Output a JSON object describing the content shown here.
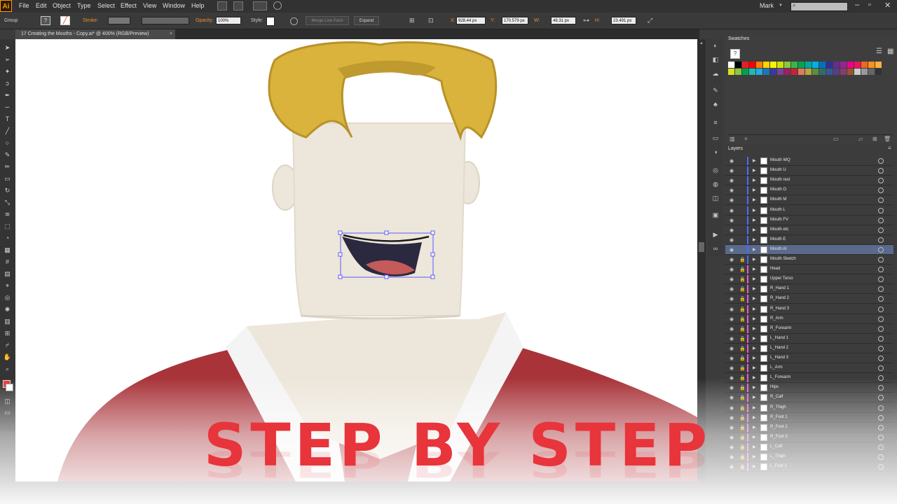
{
  "app": {
    "logo": "Ai",
    "user": "Mark"
  },
  "menu": [
    "File",
    "Edit",
    "Object",
    "Type",
    "Select",
    "Effect",
    "View",
    "Window",
    "Help"
  ],
  "control_bar": {
    "selection_type": "Group",
    "stroke_label": "Stroke:",
    "opacity_label": "Opacity:",
    "opacity_value": "100%",
    "style_label": "Style:",
    "merge_label": "Merge Live Paint",
    "expand_label": "Expand",
    "x_label": "X:",
    "x_value": "928.44 px",
    "y_label": "Y:",
    "y_value": "170.579 px",
    "w_label": "W:",
    "w_value": "48.31 px",
    "h_label": "H:",
    "h_value": "23.491 px"
  },
  "document": {
    "tab_title": "17 Creating the Mouths - Copy.ai* @ 400% (RGB/Preview)"
  },
  "panels": {
    "swatches_title": "Swatches",
    "layers_title": "Layers"
  },
  "layers": [
    {
      "name": "Mouth WQ",
      "color": "#4f6bff"
    },
    {
      "name": "Mouth U",
      "color": "#4f6bff"
    },
    {
      "name": "Mouth rest",
      "color": "#4f6bff"
    },
    {
      "name": "Mouth O",
      "color": "#4f6bff"
    },
    {
      "name": "Mouth M",
      "color": "#4f6bff"
    },
    {
      "name": "Mouth L",
      "color": "#4f6bff"
    },
    {
      "name": "Mouth FV",
      "color": "#4f6bff"
    },
    {
      "name": "Mouth etc",
      "color": "#4f6bff"
    },
    {
      "name": "Mouth E",
      "color": "#4f6bff"
    },
    {
      "name": "Mouth AI",
      "color": "#4f6bff",
      "selected": true
    },
    {
      "name": "Mouth Sketch",
      "color": "#4f6bff"
    },
    {
      "name": "Head",
      "color": "#e05bd8"
    },
    {
      "name": "Upper Torso",
      "color": "#e05bd8"
    },
    {
      "name": "R_Hand 1",
      "color": "#e05bd8"
    },
    {
      "name": "R_Hand 2",
      "color": "#e05bd8"
    },
    {
      "name": "R_Hand 3",
      "color": "#e05bd8"
    },
    {
      "name": "R_Arm",
      "color": "#e05bd8"
    },
    {
      "name": "R_Forearm",
      "color": "#e05bd8"
    },
    {
      "name": "L_Hand 1",
      "color": "#e05bd8"
    },
    {
      "name": "L_Hand 2",
      "color": "#e05bd8"
    },
    {
      "name": "L_Hand 3",
      "color": "#e05bd8"
    },
    {
      "name": "L_Arm",
      "color": "#e05bd8"
    },
    {
      "name": "L_Forearm",
      "color": "#e05bd8"
    },
    {
      "name": "Hips",
      "color": "#e05bd8"
    },
    {
      "name": "R_Calf",
      "color": "#e05bd8"
    },
    {
      "name": "R_Thigh",
      "color": "#e05bd8"
    },
    {
      "name": "R_Foot 1",
      "color": "#e05bd8"
    },
    {
      "name": "R_Foot 2",
      "color": "#e05bd8"
    },
    {
      "name": "R_Foot 3",
      "color": "#e05bd8"
    },
    {
      "name": "L_Calf",
      "color": "#e05bd8"
    },
    {
      "name": "L_Thigh",
      "color": "#e05bd8"
    },
    {
      "name": "L_Foot 1",
      "color": "#e05bd8"
    }
  ],
  "swatch_colors": [
    "#ffffff",
    "#000000",
    "#ed1c24",
    "#ff0000",
    "#ff7f00",
    "#ffd200",
    "#fff200",
    "#c8e600",
    "#8dc63f",
    "#39b54a",
    "#00a651",
    "#00a99d",
    "#00aeef",
    "#0072bc",
    "#2e3192",
    "#662d91",
    "#92278f",
    "#ec008c",
    "#ed145b",
    "#f26522",
    "#f7941d",
    "#fbb040",
    "#d7df23",
    "#8bc541",
    "#00a14b",
    "#1cbbb4",
    "#27aae1",
    "#1c75bc",
    "#3a3a9a",
    "#7f3f98",
    "#9e1f63",
    "#c1272d",
    "#e07a5f",
    "#b5a642",
    "#5a8f3a",
    "#2a6f6f",
    "#35589a",
    "#5a3d8a",
    "#8a3a6f",
    "#a0522d",
    "#cccccc",
    "#999999",
    "#666666",
    "#333333"
  ],
  "overlay": {
    "headline": "STEP BY STEP"
  },
  "colors": {
    "accent": "#e8343b",
    "hair": "#d9b33b",
    "skin": "#ede6da",
    "shirt": "#a8343a"
  }
}
